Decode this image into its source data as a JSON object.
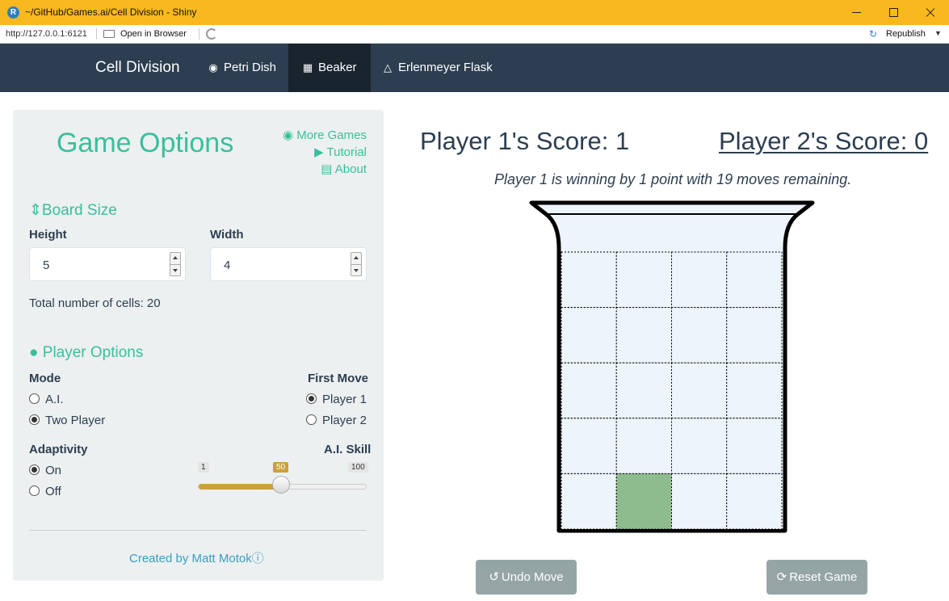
{
  "window": {
    "title": "~/GitHub/Games.ai/Cell Division - Shiny",
    "app_icon_letter": "R"
  },
  "toolbar": {
    "url": "http://127.0.0.1:6121",
    "open_in_browser": "Open in Browser",
    "publish": "Republish"
  },
  "navbar": {
    "brand": "Cell Division",
    "tabs": [
      {
        "label": "Petri Dish",
        "icon": "dot-circle-icon",
        "active": false
      },
      {
        "label": "Beaker",
        "icon": "table-icon",
        "active": true
      },
      {
        "label": "Erlenmeyer Flask",
        "icon": "flask-icon",
        "active": false
      }
    ]
  },
  "sidebar": {
    "title": "Game Options",
    "links": [
      {
        "label": "More Games",
        "icon": "github-icon"
      },
      {
        "label": "Tutorial",
        "icon": "play-circle-icon"
      },
      {
        "label": "About",
        "icon": "book-icon"
      }
    ],
    "board_size": {
      "heading": "Board Size",
      "height_label": "Height",
      "height_value": "5",
      "width_label": "Width",
      "width_value": "4",
      "total_text": "Total number of cells: 20"
    },
    "player_options": {
      "heading": "Player Options",
      "mode_label": "Mode",
      "mode_options": [
        "A.I.",
        "Two Player"
      ],
      "mode_selected": "Two Player",
      "first_move_label": "First Move",
      "first_move_options": [
        "Player 1",
        "Player 2"
      ],
      "first_move_selected": "Player 1",
      "adaptivity_label": "Adaptivity",
      "adaptivity_options": [
        "On",
        "Off"
      ],
      "adaptivity_selected": "On",
      "skill_label": "A.I. Skill",
      "skill_min": "1",
      "skill_max": "100",
      "skill_value": "50"
    },
    "credit": "Created by Matt Motok"
  },
  "game": {
    "p1_score": "Player 1's Score: 1",
    "p2_score": "Player 2's Score: 0",
    "status": "Player 1 is winning by 1 point with 19 moves remaining.",
    "board": {
      "rows": 5,
      "cols": 4,
      "filled_cells": [
        {
          "row": 4,
          "col": 1,
          "color": "#8fbc8f"
        }
      ]
    },
    "undo_label": "Undo Move",
    "reset_label": "Reset Game"
  },
  "colors": {
    "accent": "#3abf9c",
    "navbar": "#2c3e50",
    "slider": "#cc9f3f",
    "cell_empty": "#edf4fb",
    "cell_filled": "#8fbc8f",
    "button": "#95a5a6"
  }
}
